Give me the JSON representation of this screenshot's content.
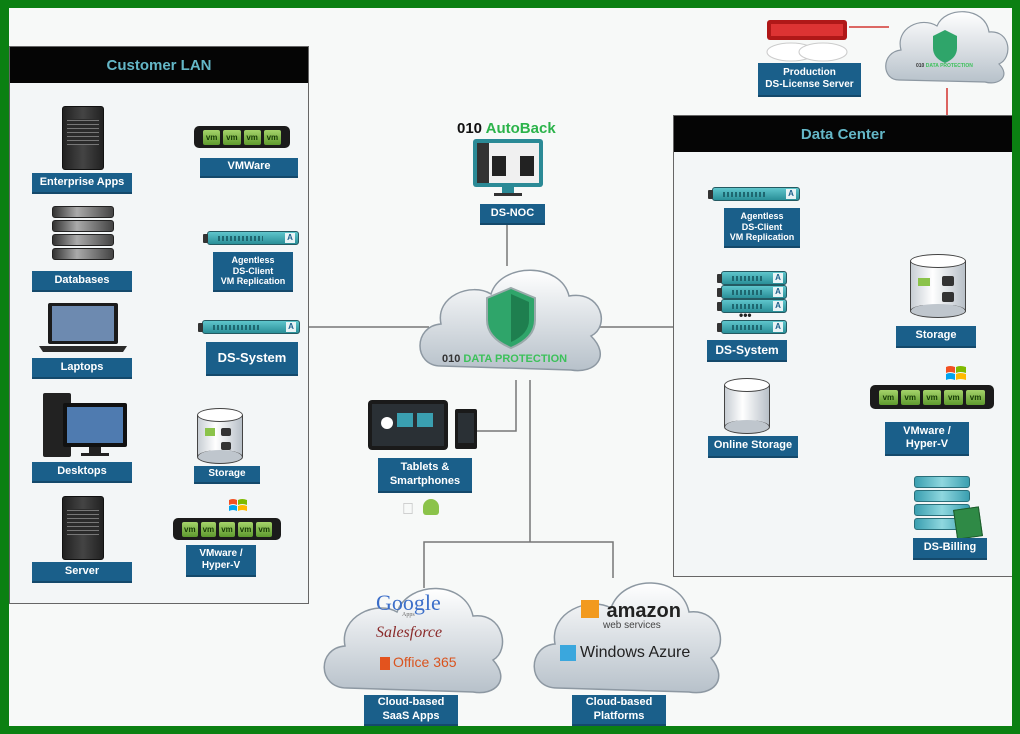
{
  "panels": {
    "customer_lan": {
      "title": "Customer LAN"
    },
    "data_center": {
      "title": "Data Center"
    }
  },
  "customer_lan": {
    "enterprise_apps": "Enterprise Apps",
    "databases": "Databases",
    "laptops": "Laptops",
    "desktops": "Desktops",
    "server": "Server",
    "vmware": "VMWare",
    "agentless": "Agentless\nDS-Client\nVM Replication",
    "ds_system": "DS-System",
    "storage": "Storage",
    "vmware_hyperv": "VMware /\nHyper-V"
  },
  "center": {
    "autoback_prefix": "010",
    "autoback_name": "AutoBack",
    "ds_noc": "DS-NOC",
    "cloud_prefix": "010",
    "cloud_name": "DATA PROTECTION",
    "tablets": "Tablets &\nSmartphones"
  },
  "license": {
    "label": "Production\nDS-License Server",
    "cloud_prefix": "010",
    "cloud_name": "DATA PROTECTION"
  },
  "data_center": {
    "agentless": "Agentless\nDS-Client\nVM Replication",
    "ds_system": "DS-System",
    "online_storage": "Online Storage",
    "storage": "Storage",
    "vmware_hyperv": "VMware /\nHyper-V",
    "ds_billing": "DS-Billing"
  },
  "clouds": {
    "saas": {
      "label": "Cloud-based\nSaaS Apps",
      "google": "Google",
      "google_sub": "Apps",
      "salesforce": "Salesforce",
      "office": "Office 365"
    },
    "platforms": {
      "label": "Cloud-based\nPlatforms",
      "amazon": "amazon",
      "amazon_sub": "web services",
      "azure": "Windows Azure"
    }
  },
  "vm_badges": {
    "vm4": [
      "vm",
      "vm",
      "vm",
      "vm"
    ],
    "vm5": [
      "vm",
      "vm",
      "vm",
      "vm",
      "vm"
    ]
  },
  "colors": {
    "label_blue": "#1a5f8a",
    "green_accent": "#2bb34a",
    "frame_green": "#0b8012",
    "red_link": "#d9534f"
  }
}
